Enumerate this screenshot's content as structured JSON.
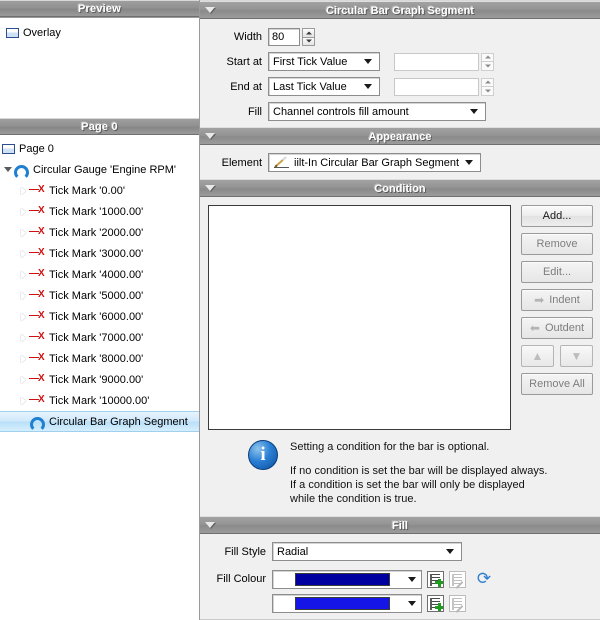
{
  "left": {
    "preview": {
      "header": "Preview",
      "items": [
        {
          "label": "Overlay",
          "icon": "page-icon"
        }
      ]
    },
    "page_panel": {
      "header": "Page 0",
      "tree": [
        {
          "label": "Page 0",
          "icon": "page-icon",
          "depth": 0,
          "expander": "none",
          "selected": false
        },
        {
          "label": "Circular Gauge 'Engine RPM'",
          "icon": "gauge-icon",
          "depth": 0,
          "expander": "open",
          "selected": false
        },
        {
          "label": "Tick Mark '0.00'",
          "icon": "tick-mark-icon",
          "depth": 1,
          "expander": "closed",
          "selected": false
        },
        {
          "label": "Tick Mark '1000.00'",
          "icon": "tick-mark-icon",
          "depth": 1,
          "expander": "closed",
          "selected": false
        },
        {
          "label": "Tick Mark '2000.00'",
          "icon": "tick-mark-icon",
          "depth": 1,
          "expander": "closed",
          "selected": false
        },
        {
          "label": "Tick Mark '3000.00'",
          "icon": "tick-mark-icon",
          "depth": 1,
          "expander": "closed",
          "selected": false
        },
        {
          "label": "Tick Mark '4000.00'",
          "icon": "tick-mark-icon",
          "depth": 1,
          "expander": "closed",
          "selected": false
        },
        {
          "label": "Tick Mark '5000.00'",
          "icon": "tick-mark-icon",
          "depth": 1,
          "expander": "closed",
          "selected": false
        },
        {
          "label": "Tick Mark '6000.00'",
          "icon": "tick-mark-icon",
          "depth": 1,
          "expander": "closed",
          "selected": false
        },
        {
          "label": "Tick Mark '7000.00'",
          "icon": "tick-mark-icon",
          "depth": 1,
          "expander": "closed",
          "selected": false
        },
        {
          "label": "Tick Mark '8000.00'",
          "icon": "tick-mark-icon",
          "depth": 1,
          "expander": "closed",
          "selected": false
        },
        {
          "label": "Tick Mark '9000.00'",
          "icon": "tick-mark-icon",
          "depth": 1,
          "expander": "closed",
          "selected": false
        },
        {
          "label": "Tick Mark '10000.00'",
          "icon": "tick-mark-icon",
          "depth": 1,
          "expander": "closed",
          "selected": false
        },
        {
          "label": "Circular Bar Graph Segment",
          "icon": "gauge-icon",
          "depth": 1,
          "expander": "none",
          "selected": true
        }
      ]
    }
  },
  "segment": {
    "header": "Circular Bar Graph Segment",
    "width_label": "Width",
    "width_value": "80",
    "start_label": "Start at",
    "start_value": "First Tick Value",
    "start_number": "",
    "end_label": "End at",
    "end_value": "Last Tick Value",
    "end_number": "",
    "fill_label": "Fill",
    "fill_value": "Channel controls fill amount"
  },
  "appearance": {
    "header": "Appearance",
    "element_label": "Element",
    "element_value": "iilt-In Circular Bar Graph Segment",
    "element_icon": "pencil-icon"
  },
  "condition": {
    "header": "Condition",
    "list_items": [],
    "buttons": {
      "add": "Add...",
      "remove": "Remove",
      "edit": "Edit...",
      "indent": "Indent",
      "outdent": "Outdent",
      "move_up": "▲",
      "move_down": "▼",
      "remove_all": "Remove All"
    },
    "info": {
      "line1": "Setting a condition for the bar is optional.",
      "line2": "If no condition is set the bar will be displayed always.",
      "line3": "If a condition is set the bar will only be displayed",
      "line4": "while the condition is true."
    }
  },
  "fill": {
    "header": "Fill",
    "style_label": "Fill Style",
    "style_value": "Radial",
    "colour_label": "Fill Colour",
    "colour_1": "#0000A0",
    "colour_2": "#1515E8",
    "swap_icon": "swap-colours-icon"
  }
}
